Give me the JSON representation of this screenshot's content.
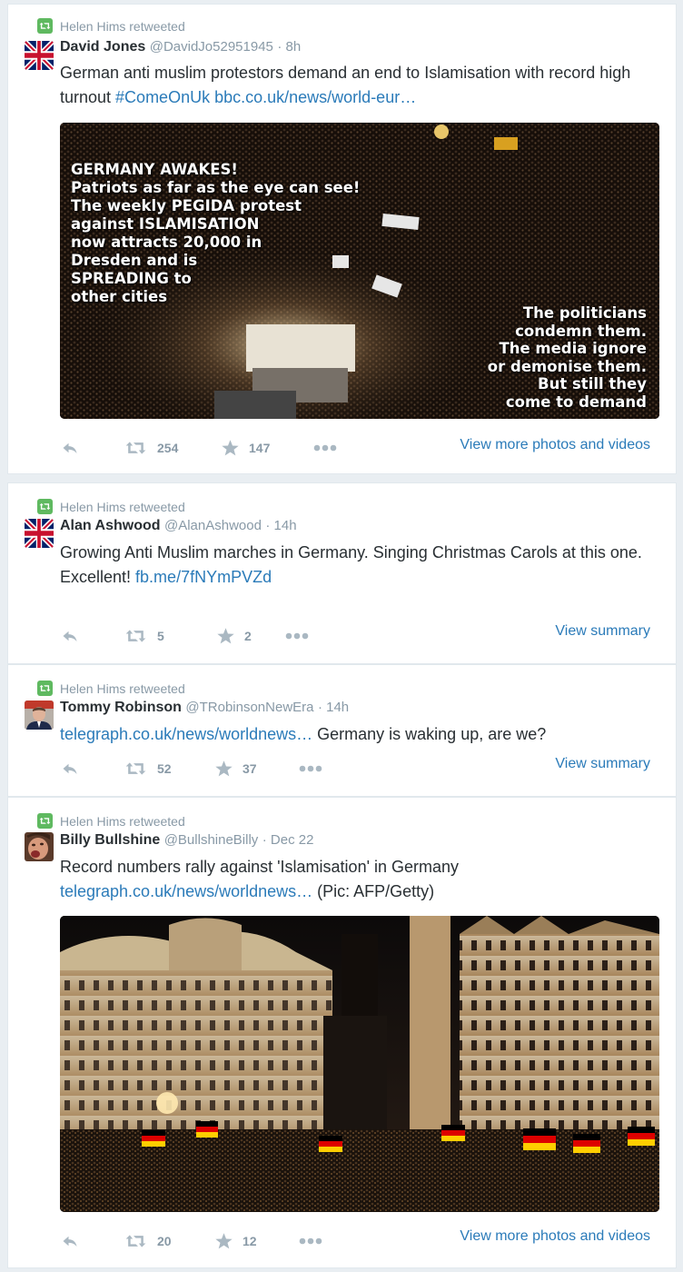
{
  "tweets": [
    {
      "retweeted_by": "Helen Hims retweeted",
      "name": "David Jones",
      "handle": "@DavidJo52951945",
      "time": "· 8h",
      "text": "German anti muslim protestors demand an end to Islamisation with record high turnout ",
      "hashtag": "#ComeOnUk",
      "link": "bbc.co.uk/news/world-eur…",
      "media_text_left": [
        "GERMANY AWAKES!",
        "Patriots as far as the eye can see!",
        "The weekly PEGIDA protest",
        "against ISLAMISATION",
        "now attracts 20,000 in",
        "Dresden and is",
        "SPREADING to",
        "other cities"
      ],
      "media_text_right": [
        "The politicians",
        "condemn them.",
        "The media ignore",
        "or demonise them.",
        "But still they",
        "come to demand"
      ],
      "retweets": "254",
      "favorites": "147",
      "view_more": "View more photos and videos"
    },
    {
      "retweeted_by": "Helen Hims retweeted",
      "name": "Alan Ashwood",
      "handle": "@AlanAshwood",
      "time": "· 14h",
      "text1": "Growing Anti Muslim marches in Germany. Singing Christmas Carols at this one.",
      "text2": "Excellent! ",
      "link": "fb.me/7fNYmPVZd",
      "retweets": "5",
      "favorites": "2",
      "view_more": "View summary"
    },
    {
      "retweeted_by": "Helen Hims retweeted",
      "name": "Tommy Robinson",
      "handle": "@TRobinsonNewEra",
      "time": "· 14h",
      "link": "telegraph.co.uk/news/worldnews…",
      "text": " Germany is waking up, are we?",
      "retweets": "52",
      "favorites": "37",
      "view_more": "View summary"
    },
    {
      "retweeted_by": "Helen Hims retweeted",
      "name": "Billy Bullshine",
      "handle": "@BullshineBilly",
      "time": "· Dec 22",
      "text": "Record numbers rally against 'Islamisation' in Germany",
      "link": "telegraph.co.uk/news/worldnews…",
      "text2": " (Pic: AFP/Getty)",
      "retweets": "20",
      "favorites": "12",
      "view_more": "View more photos and videos"
    }
  ],
  "icons": {
    "retweet_badge": "retweet-icon",
    "reply": "reply-icon",
    "retweet": "retweet-icon",
    "favorite": "star-icon",
    "more": "more-dots-icon"
  },
  "colors": {
    "link": "#2b7bb9",
    "retweet_badge": "#5fb960",
    "muted": "#8899a6"
  }
}
